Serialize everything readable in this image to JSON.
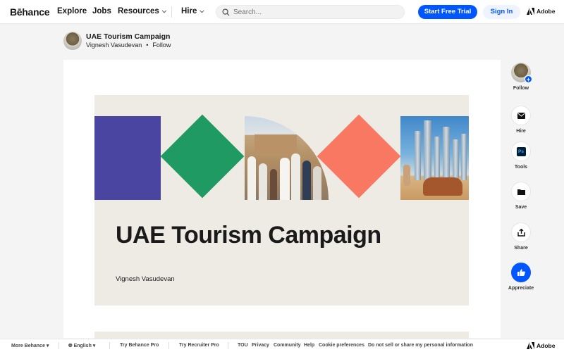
{
  "nav": {
    "logo": "Bēhance",
    "explore": "Explore",
    "jobs": "Jobs",
    "resources": "Resources",
    "hire": "Hire",
    "search_placeholder": "Search...",
    "trial_button": "Start Free Trial",
    "signin_button": "Sign In",
    "adobe": "Adobe"
  },
  "project": {
    "title": "UAE Tourism Campaign",
    "owner": "Vignesh Vasudevan",
    "separator": "•",
    "follow": "Follow"
  },
  "slide": {
    "title": "UAE Tourism Campaign",
    "author": "Vignesh Vasudevan",
    "colors": {
      "purple": "#4a45a0",
      "green": "#1f9a62",
      "coral": "#f87862",
      "background": "#eeebe4"
    }
  },
  "rail": {
    "follow": "Follow",
    "hire": "Hire",
    "tools": "Tools",
    "tools_badge": "Ps",
    "save": "Save",
    "share": "Share",
    "appreciate": "Appreciate"
  },
  "footer": {
    "more": "More Behance",
    "language": "English",
    "try_pro": "Try Behance Pro",
    "try_recruiter": "Try Recruiter Pro",
    "tou": "TOU",
    "privacy": "Privacy",
    "community": "Community",
    "help": "Help",
    "cookies": "Cookie preferences",
    "do_not_sell": "Do not sell or share my personal information",
    "adobe": "Adobe"
  },
  "colors": {
    "accent": "#0057ff"
  }
}
